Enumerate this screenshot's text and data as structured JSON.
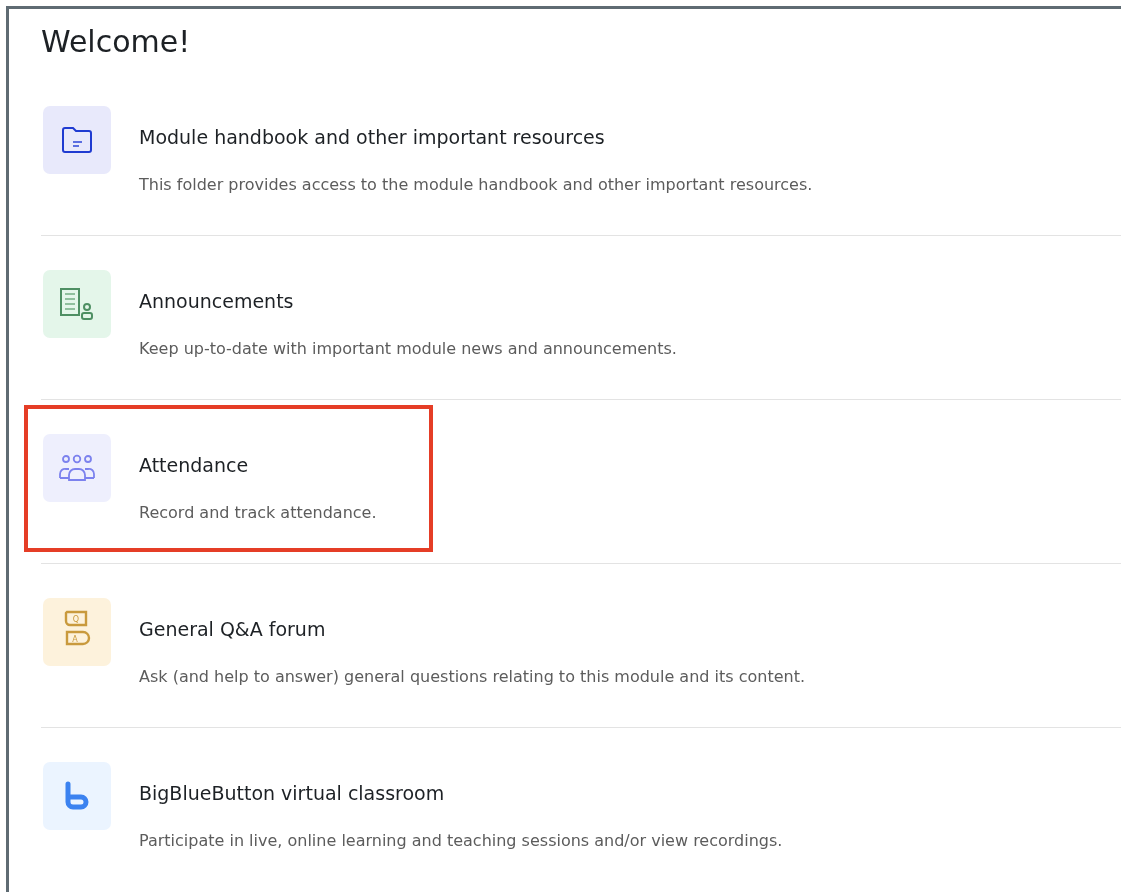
{
  "heading": "Welcome!",
  "items": [
    {
      "kind": "folder",
      "title": "Module handbook and other important resources",
      "description": "This folder provides access to the module handbook and other important resources.",
      "highlighted": false
    },
    {
      "kind": "announcement",
      "title": "Announcements",
      "description": "Keep up-to-date with important module news and announcements.",
      "highlighted": false
    },
    {
      "kind": "people",
      "title": "Attendance",
      "description": "Record and track attendance.",
      "highlighted": true
    },
    {
      "kind": "qa",
      "icon_letters": [
        "Q",
        "A"
      ],
      "title": "General Q&A forum",
      "description": "Ask (and help to answer) general questions relating to this module and its content.",
      "highlighted": false
    },
    {
      "kind": "bbb",
      "title": "BigBlueButton virtual classroom",
      "description": "Participate in live, online learning and teaching sessions and/or view recordings.",
      "highlighted": false
    }
  ]
}
